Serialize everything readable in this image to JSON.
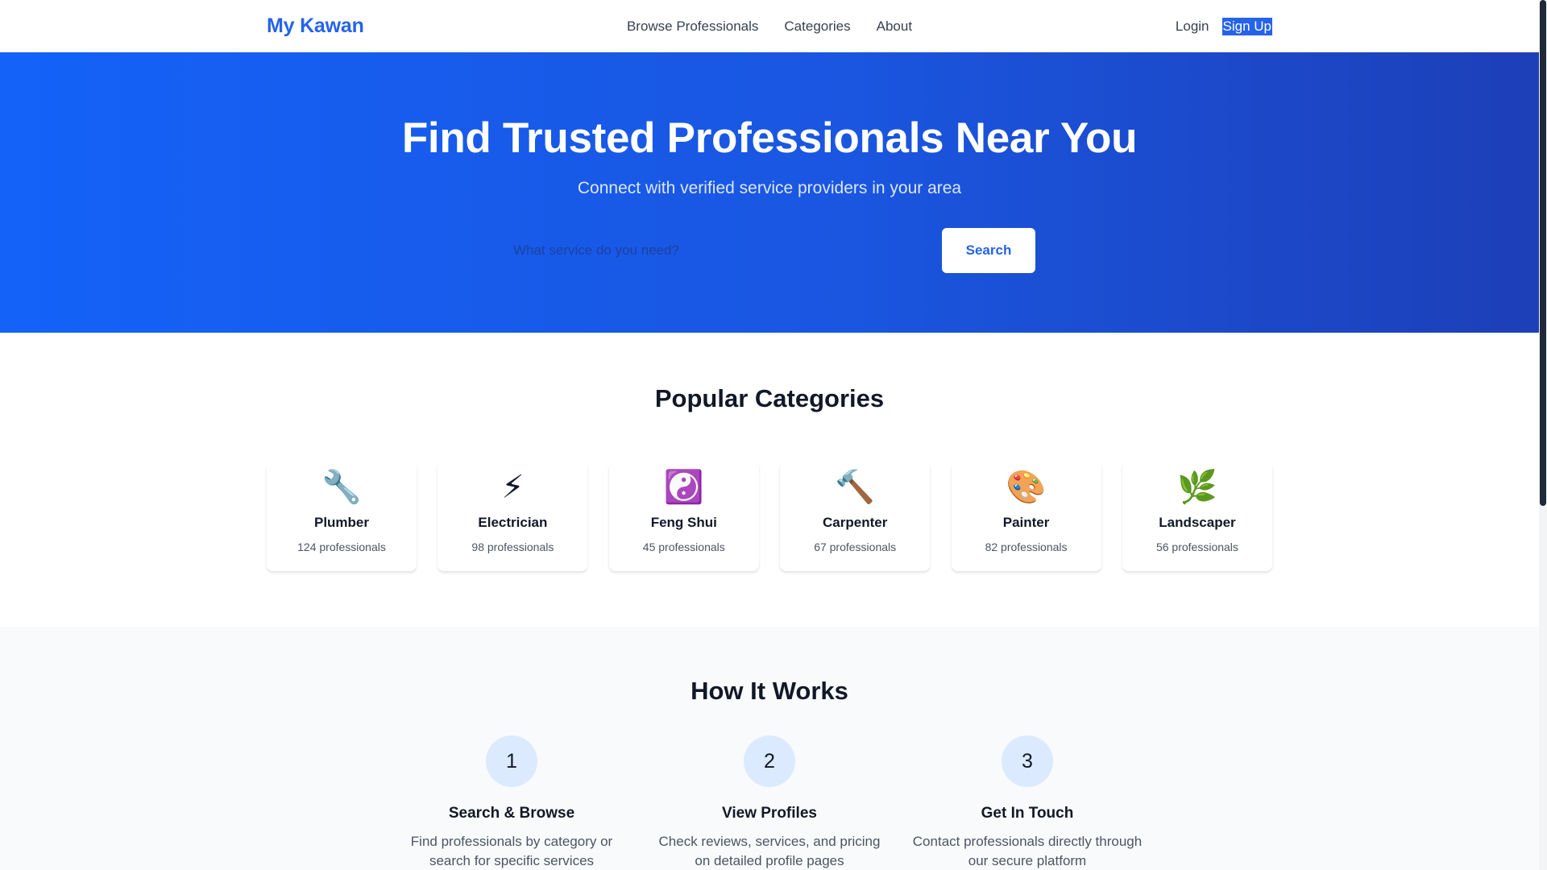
{
  "header": {
    "logo": "My Kawan",
    "nav": [
      "Browse Professionals",
      "Categories",
      "About"
    ],
    "login": "Login",
    "signup": "Sign Up"
  },
  "hero": {
    "title": "Find Trusted Professionals Near You",
    "subtitle": "Connect with verified service providers in your area",
    "search_placeholder": "What service do you need?",
    "search_button": "Search"
  },
  "categories": {
    "title": "Popular Categories",
    "items": [
      {
        "icon": "🔧",
        "icon_name": "wrench-icon",
        "name": "Plumber",
        "count": "124 professionals"
      },
      {
        "icon": "⚡",
        "icon_name": "lightning-icon",
        "name": "Electrician",
        "count": "98 professionals"
      },
      {
        "icon": "☯️",
        "icon_name": "yin-yang-icon",
        "name": "Feng Shui",
        "count": "45 professionals"
      },
      {
        "icon": "🔨",
        "icon_name": "hammer-icon",
        "name": "Carpenter",
        "count": "67 professionals"
      },
      {
        "icon": "🎨",
        "icon_name": "palette-icon",
        "name": "Painter",
        "count": "82 professionals"
      },
      {
        "icon": "🌿",
        "icon_name": "herb-icon",
        "name": "Landscaper",
        "count": "56 professionals"
      }
    ]
  },
  "how": {
    "title": "How It Works",
    "steps": [
      {
        "num": "1",
        "title": "Search & Browse",
        "desc": "Find professionals by category or search for specific services"
      },
      {
        "num": "2",
        "title": "View Profiles",
        "desc": "Check reviews, services, and pricing on detailed profile pages"
      },
      {
        "num": "3",
        "title": "Get In Touch",
        "desc": "Contact professionals directly through our secure platform"
      }
    ]
  },
  "colors": {
    "brand": "#2563eb",
    "hero_start": "#1462f8",
    "hero_end": "#1d3fb8",
    "step_circle": "#dbeafe"
  }
}
